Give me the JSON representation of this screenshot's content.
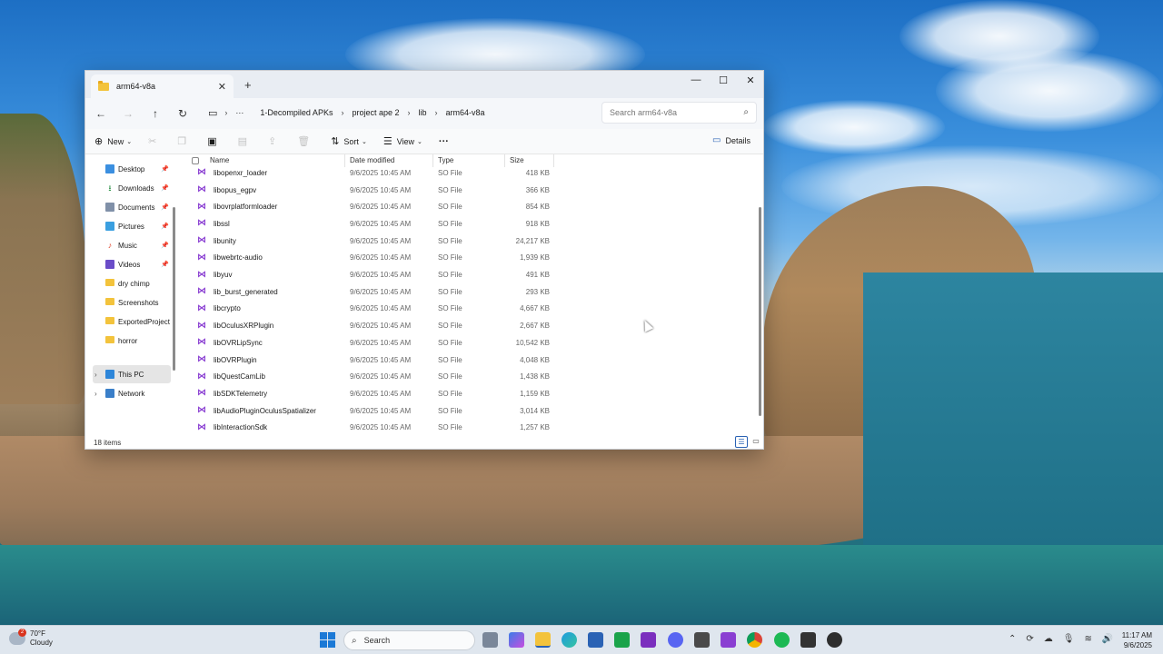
{
  "window": {
    "tab_title": "arm64-v8a",
    "tab_close": "✕",
    "new_tab": "+",
    "minimize": "—",
    "maximize": "☐",
    "close": "✕"
  },
  "nav": {
    "back": "←",
    "forward": "→",
    "up": "↑",
    "refresh": "↻"
  },
  "address": {
    "pc_icon": "▭",
    "more": "···",
    "segments": [
      "1-Decompiled APKs",
      "project ape 2",
      "lib",
      "arm64-v8a"
    ],
    "separator": "›"
  },
  "search": {
    "placeholder": "Search arm64-v8a",
    "icon": "⌕"
  },
  "toolbar": {
    "new_label": "New",
    "sort_label": "Sort",
    "view_label": "View",
    "more_label": "···",
    "details_label": "Details"
  },
  "sidebar": {
    "items": [
      {
        "label": "Desktop",
        "icon": "desktop-icon",
        "pinned": true
      },
      {
        "label": "Downloads",
        "icon": "download-icon",
        "pinned": true
      },
      {
        "label": "Documents",
        "icon": "document-icon",
        "pinned": true
      },
      {
        "label": "Pictures",
        "icon": "picture-icon",
        "pinned": true
      },
      {
        "label": "Music",
        "icon": "music-icon",
        "pinned": true
      },
      {
        "label": "Videos",
        "icon": "video-icon",
        "pinned": true
      },
      {
        "label": "dry chimp",
        "icon": "folder-icon",
        "pinned": false
      },
      {
        "label": "Screenshots",
        "icon": "folder-icon",
        "pinned": false
      },
      {
        "label": "ExportedProject",
        "icon": "folder-icon",
        "pinned": false
      },
      {
        "label": "horror",
        "icon": "folder-icon",
        "pinned": false
      },
      {
        "label": "This PC",
        "icon": "pc-icon",
        "pinned": false
      },
      {
        "label": "Network",
        "icon": "network-icon",
        "pinned": false
      }
    ]
  },
  "columns": {
    "name": "Name",
    "date": "Date modified",
    "type": "Type",
    "size": "Size"
  },
  "files": [
    {
      "name": "libopenxr_loader",
      "date": "9/6/2025 10:45 AM",
      "type": "SO File",
      "size": "418 KB"
    },
    {
      "name": "libopus_egpv",
      "date": "9/6/2025 10:45 AM",
      "type": "SO File",
      "size": "366 KB"
    },
    {
      "name": "libovrplatformloader",
      "date": "9/6/2025 10:45 AM",
      "type": "SO File",
      "size": "854 KB"
    },
    {
      "name": "libssl",
      "date": "9/6/2025 10:45 AM",
      "type": "SO File",
      "size": "918 KB"
    },
    {
      "name": "libunity",
      "date": "9/6/2025 10:45 AM",
      "type": "SO File",
      "size": "24,217 KB"
    },
    {
      "name": "libwebrtc-audio",
      "date": "9/6/2025 10:45 AM",
      "type": "SO File",
      "size": "1,939 KB"
    },
    {
      "name": "libyuv",
      "date": "9/6/2025 10:45 AM",
      "type": "SO File",
      "size": "491 KB"
    },
    {
      "name": "lib_burst_generated",
      "date": "9/6/2025 10:45 AM",
      "type": "SO File",
      "size": "293 KB"
    },
    {
      "name": "libcrypto",
      "date": "9/6/2025 10:45 AM",
      "type": "SO File",
      "size": "4,667 KB"
    },
    {
      "name": "libOculusXRPlugin",
      "date": "9/6/2025 10:45 AM",
      "type": "SO File",
      "size": "2,667 KB"
    },
    {
      "name": "libOVRLipSync",
      "date": "9/6/2025 10:45 AM",
      "type": "SO File",
      "size": "10,542 KB"
    },
    {
      "name": "libOVRPlugin",
      "date": "9/6/2025 10:45 AM",
      "type": "SO File",
      "size": "4,048 KB"
    },
    {
      "name": "libQuestCamLib",
      "date": "9/6/2025 10:45 AM",
      "type": "SO File",
      "size": "1,438 KB"
    },
    {
      "name": "libSDKTelemetry",
      "date": "9/6/2025 10:45 AM",
      "type": "SO File",
      "size": "1,159 KB"
    },
    {
      "name": "libAudioPluginOculusSpatializer",
      "date": "9/6/2025 10:45 AM",
      "type": "SO File",
      "size": "3,014 KB"
    },
    {
      "name": "libInteractionSdk",
      "date": "9/6/2025 10:45 AM",
      "type": "SO File",
      "size": "1,257 KB"
    }
  ],
  "status": {
    "item_count": "18 items"
  },
  "taskbar": {
    "weather_temp": "70°F",
    "weather_desc": "Cloudy",
    "weather_badge": "2",
    "search_label": "Search",
    "time": "11:17 AM",
    "date": "9/6/2025",
    "colors": {
      "start": "#1b79d6",
      "accent": "#2a62b4"
    }
  }
}
